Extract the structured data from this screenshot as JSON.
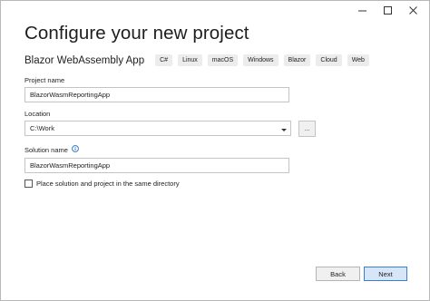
{
  "window": {
    "controls": [
      "minimize-icon",
      "maximize-icon",
      "close-icon"
    ]
  },
  "header": {
    "title": "Configure your new project"
  },
  "template": {
    "name": "Blazor WebAssembly App",
    "tags": [
      "C#",
      "Linux",
      "macOS",
      "Windows",
      "Blazor",
      "Cloud",
      "Web"
    ]
  },
  "form": {
    "project_name_label": "Project name",
    "project_name_value": "BlazorWasmReportingApp",
    "location_label": "Location",
    "location_value": "C:\\Work",
    "browse_label": "...",
    "solution_name_label": "Solution name",
    "solution_name_value": "BlazorWasmReportingApp",
    "same_directory_label": "Place solution and project in the same directory",
    "same_directory_checked": false
  },
  "footer": {
    "back_label": "Back",
    "next_label": "Next"
  },
  "colors": {
    "accent_border": "#3c7fd2",
    "accent_fill": "#d6e6f8",
    "info_icon": "#1e6fc7"
  }
}
